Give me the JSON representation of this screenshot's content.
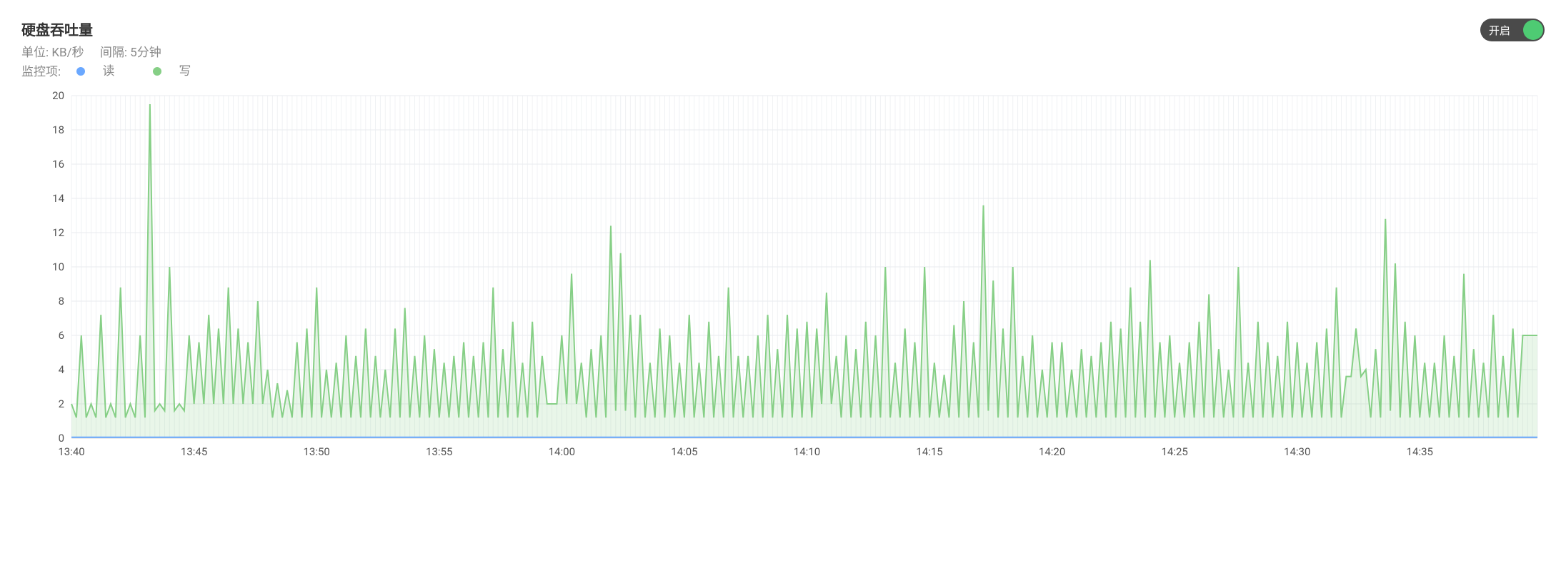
{
  "title": "硬盘吞吐量",
  "unit_label": "单位: KB/秒",
  "interval_label": "间隔: 5分钟",
  "monitor_label": "监控项:",
  "toggle": {
    "on_label": "开启",
    "state": "on"
  },
  "legend": {
    "read": {
      "label": "读",
      "color": "#6aa8ff"
    },
    "write": {
      "label": "写",
      "color": "#86cf86"
    }
  },
  "chart_data": {
    "type": "line",
    "title": "硬盘吞吐量",
    "xlabel": "",
    "ylabel": "",
    "ylim": [
      0,
      20
    ],
    "y_ticks": [
      0,
      2,
      4,
      6,
      8,
      10,
      12,
      14,
      16,
      18,
      20
    ],
    "x_tick_labels": [
      "13:40",
      "13:45",
      "13:50",
      "13:55",
      "14:00",
      "14:05",
      "14:10",
      "14:15",
      "14:20",
      "14:25",
      "14:30",
      "14:35"
    ],
    "x_tick_indices": [
      0,
      25,
      50,
      75,
      100,
      125,
      150,
      175,
      200,
      225,
      250,
      275
    ],
    "n_points": 300,
    "series": [
      {
        "name": "读",
        "color": "#6aa8ff",
        "values_flat": 0.05
      },
      {
        "name": "写",
        "color": "#86cf86",
        "values": [
          2,
          1.2,
          6,
          1.2,
          2,
          1.2,
          7.2,
          1.2,
          2,
          1.2,
          8.8,
          1.2,
          2,
          1.2,
          6,
          1.2,
          19.5,
          1.6,
          2,
          1.6,
          10,
          1.6,
          2,
          1.6,
          6,
          2,
          5.6,
          2,
          7.2,
          2,
          6.4,
          2,
          8.8,
          2,
          6.4,
          2,
          5.6,
          2,
          8,
          2,
          4,
          1.2,
          3.2,
          1.2,
          2.8,
          1.2,
          5.6,
          1.2,
          6.4,
          1.2,
          8.8,
          1.2,
          4,
          1.2,
          4.4,
          1.2,
          6,
          1.2,
          4.8,
          1.2,
          6.4,
          1.2,
          4.8,
          1.2,
          4,
          1.2,
          6.4,
          1.2,
          7.6,
          1.2,
          4.8,
          1.2,
          6,
          1.2,
          5.2,
          1.2,
          4.4,
          1.2,
          4.8,
          1.2,
          5.6,
          1.2,
          4.8,
          1.2,
          5.6,
          1.2,
          8.8,
          1.2,
          5.2,
          1.2,
          6.8,
          1.2,
          4.4,
          1.2,
          6.8,
          1.2,
          4.8,
          2,
          2,
          2,
          6,
          2,
          9.6,
          2,
          4.4,
          1.2,
          5.2,
          1.2,
          6,
          1.2,
          12.4,
          1.6,
          10.8,
          1.6,
          7.2,
          1.2,
          7.2,
          1.2,
          4.4,
          1.2,
          6.4,
          1.2,
          6,
          1.2,
          4.4,
          1.2,
          7.2,
          1.2,
          4.4,
          1.2,
          6.8,
          1.2,
          4.8,
          1.2,
          8.8,
          1.2,
          4.8,
          1.2,
          4.8,
          1.2,
          6,
          1.2,
          7.2,
          1.2,
          5.2,
          1.2,
          7.2,
          1.2,
          6.4,
          1.2,
          6.8,
          1.2,
          6.4,
          2,
          8.5,
          2,
          4.8,
          1.2,
          6,
          1.2,
          5.2,
          1.2,
          6.8,
          1.2,
          6,
          1.2,
          10,
          1.2,
          4.4,
          1.2,
          6.4,
          1.2,
          5.6,
          1.2,
          10,
          1.2,
          4.4,
          1.2,
          3.7,
          1.2,
          6.6,
          1.2,
          8,
          1.2,
          5.6,
          1.2,
          13.6,
          1.6,
          9.2,
          1.2,
          6.4,
          1.2,
          10,
          1.2,
          4.8,
          1.2,
          6,
          1.2,
          4,
          1.2,
          5.6,
          1.2,
          5.6,
          1.2,
          4,
          1.2,
          5.2,
          1.2,
          4.8,
          1.2,
          5.6,
          1.2,
          6.8,
          1.2,
          6.4,
          1.2,
          8.8,
          1.2,
          6.8,
          1.2,
          10.4,
          1.2,
          5.6,
          1.2,
          6,
          1.2,
          4.4,
          1.2,
          5.6,
          1.2,
          6.8,
          1.2,
          8.4,
          1.2,
          5.2,
          1.2,
          4,
          1.2,
          10,
          1.2,
          4.4,
          1.2,
          6.8,
          1.2,
          5.6,
          1.2,
          4.8,
          1.2,
          6.8,
          1.2,
          5.6,
          1.2,
          4.4,
          1.2,
          5.6,
          1.2,
          6.4,
          1.2,
          8.8,
          1.2,
          3.6,
          3.6,
          6.4,
          3.6,
          4,
          1.2,
          5.2,
          1.2,
          12.8,
          1.6,
          10.2,
          1.2,
          6.8,
          1.2,
          6,
          1.2,
          4.4,
          1.2,
          4.4,
          1.2,
          6,
          1.2,
          4.8,
          1.2,
          9.6,
          1.2,
          5.2,
          1.2,
          4.4,
          1.2,
          7.2,
          1.2,
          4.8,
          1.2,
          6.4,
          1.2,
          6
        ]
      }
    ]
  }
}
